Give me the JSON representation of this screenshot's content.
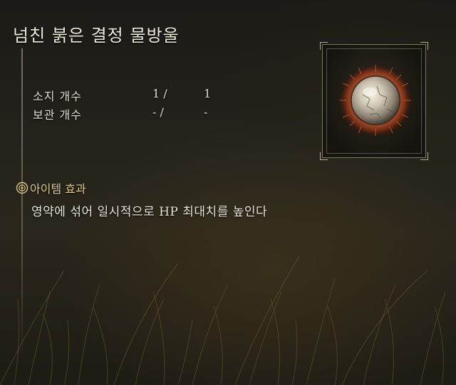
{
  "item": {
    "name": "넘친 붉은 결정 물방울"
  },
  "stats": [
    {
      "label": "소지 개수",
      "held": "1 /",
      "max": "1"
    },
    {
      "label": "보관 개수",
      "held": "- /",
      "max": "-"
    }
  ],
  "effect": {
    "header": "아이템 효과",
    "description": "영약에 섞어 일시적으로 HP 최대치를 높인다"
  },
  "icons": {
    "item": "red-crystal-tear-icon",
    "effect": "item-effect-icon"
  },
  "colors": {
    "title": "#ece7da",
    "effect_header": "#dccb94",
    "crystal_ring": "#8a3a1e"
  }
}
